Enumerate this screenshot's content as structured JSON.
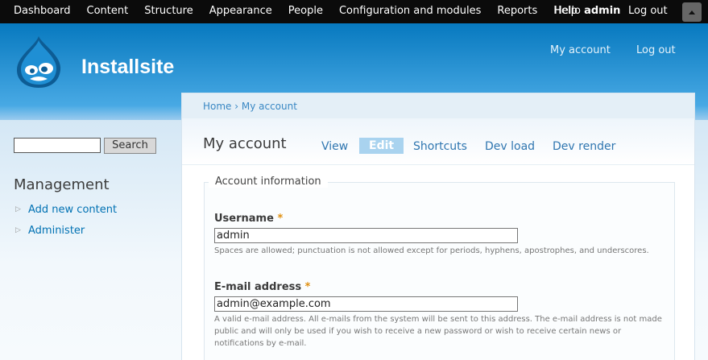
{
  "toolbar": {
    "items": [
      "Dashboard",
      "Content",
      "Structure",
      "Appearance",
      "People",
      "Configuration and modules",
      "Reports",
      "Help"
    ],
    "greeting": "Hello ",
    "username": "admin",
    "logout": "Log out"
  },
  "header": {
    "site_name": "Installsite",
    "menu": [
      "My account",
      "Log out"
    ]
  },
  "sidebar": {
    "search_button": "Search",
    "search_value": "",
    "block_title": "Management",
    "items": [
      "Add new content",
      "Administer"
    ]
  },
  "main": {
    "breadcrumb": "Home › My account",
    "title": "My account",
    "tabs": [
      "View",
      "Edit",
      "Shortcuts",
      "Dev load",
      "Dev render"
    ],
    "active_tab": "Edit",
    "fieldset_legend": "Account information",
    "username": {
      "label": "Username",
      "required": "*",
      "value": "admin",
      "description": "Spaces are allowed; punctuation is not allowed except for periods, hyphens, apostrophes, and underscores."
    },
    "email": {
      "label": "E-mail address",
      "required": "*",
      "value": "admin@example.com",
      "description": "A valid e-mail address. All e-mails from the system will be sent to this address. The e-mail address is not made public and will only be used if you wish to receive a new password or wish to receive certain news or notifications by e-mail."
    }
  },
  "colors": {
    "toolbar_bg": "#0b0b0b",
    "header_blue": "#0779bf",
    "link_blue": "#0071b3",
    "active_tab": "#a9d3ef",
    "required": "#e09010"
  }
}
